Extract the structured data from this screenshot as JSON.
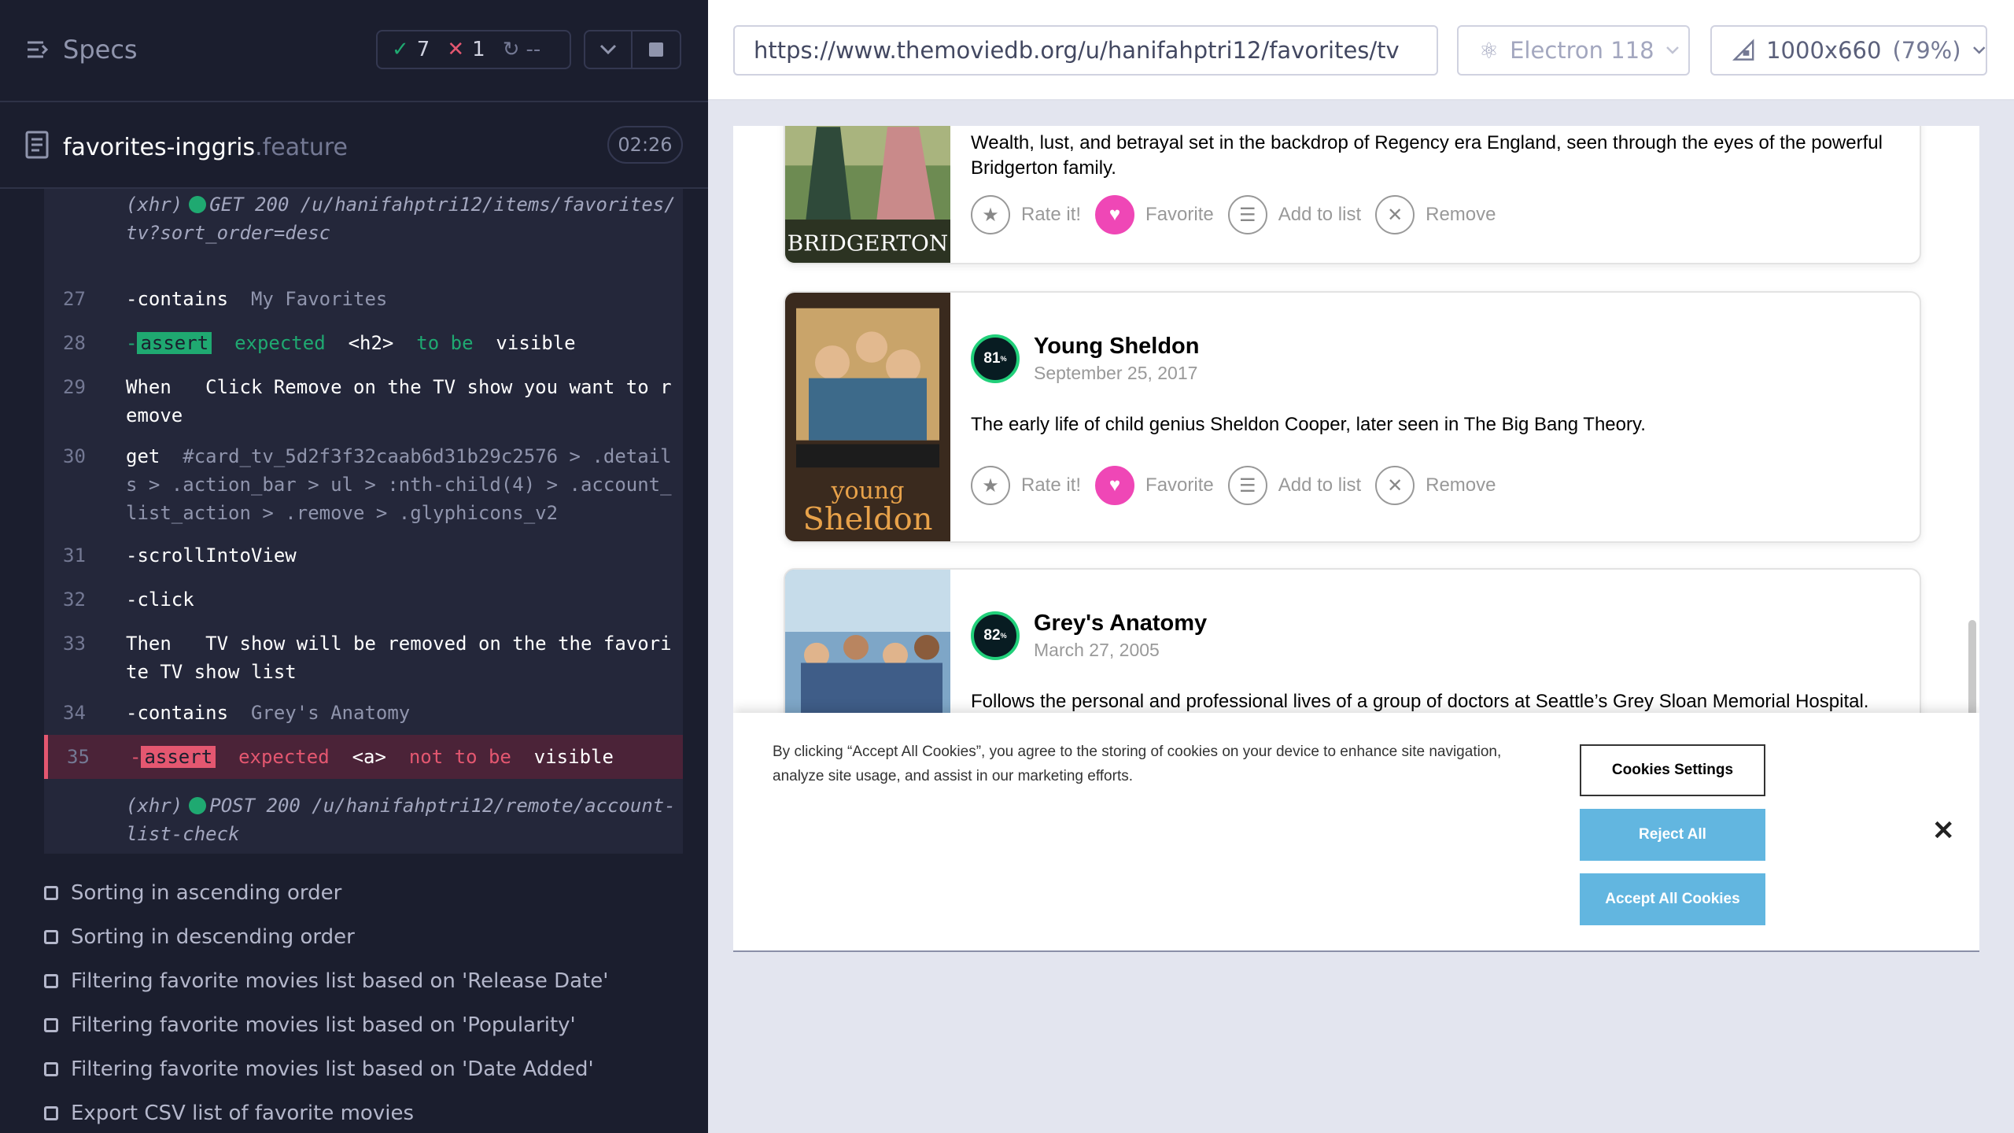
{
  "reporter": {
    "specs_label": "Specs",
    "stats": {
      "passed": "7",
      "failed": "1",
      "pending": "--"
    },
    "spec_file": {
      "name": "favorites-inggris",
      "ext": ".feature",
      "duration": "02:26"
    },
    "commands": [
      {
        "num": "",
        "lines": "(xhr)",
        "method": "GET 200",
        "path": "/u/hanifahptri12/items/favorites/tv?sort_order=desc"
      },
      {
        "num": "27",
        "cmd": "-contains",
        "arg": "My Favorites"
      },
      {
        "num": "28",
        "cmd": "-",
        "badge": "assert",
        "text": "expected",
        "el": "<h2>",
        "mid": "to be",
        "end": "visible"
      },
      {
        "num": "29",
        "cmd": "When",
        "text": "Click Remove on the TV show you want to remove"
      },
      {
        "num": "30",
        "cmd": "get",
        "arg": "#card_tv_5d2f3f32caab6d31b29c2576 > .details > .action_bar > ul > :nth-child(4) > .account_list_action > .remove > .glyphicons_v2"
      },
      {
        "num": "31",
        "cmd": "-scrollIntoView"
      },
      {
        "num": "32",
        "cmd": "-click"
      },
      {
        "num": "33",
        "cmd": "Then",
        "text": "TV show will be removed on the the favorite TV show list"
      },
      {
        "num": "34",
        "cmd": "-contains",
        "arg": "Grey's Anatomy"
      },
      {
        "num": "35",
        "cmd": "-",
        "badge": "assert",
        "text": "expected",
        "el": "<a>",
        "mid": "not to be",
        "end": "visible"
      },
      {
        "num": "",
        "lines": "(xhr)",
        "method": "POST 200",
        "path": "/u/hanifahptri12/remote/account-list-check"
      }
    ],
    "tests": [
      "Sorting in ascending order",
      "Sorting in descending order",
      "Filtering favorite movies list based on 'Release Date'",
      "Filtering favorite movies list based on 'Popularity'",
      "Filtering favorite movies list based on 'Date Added'",
      "Export CSV list of favorite movies"
    ]
  },
  "aut": {
    "url": "https://www.themoviedb.org/u/hanifahptri12/favorites/tv",
    "browser": "Electron 118",
    "viewport": "1000x660",
    "zoom": "(79%)"
  },
  "page": {
    "shows": [
      {
        "poster_text": "BRIDGERTON",
        "overview": "Wealth, lust, and betrayal set in the backdrop of Regency era England, seen through the eyes of the powerful Bridgerton family."
      },
      {
        "poster_text_1": "young",
        "poster_text_2": "Sheldon",
        "score": "81",
        "title": "Young Sheldon",
        "date": "September 25, 2017",
        "overview": "The early life of child genius Sheldon Cooper, later seen in The Big Bang Theory."
      },
      {
        "score": "82",
        "title": "Grey's Anatomy",
        "date": "March 27, 2005",
        "overview": "Follows the personal and professional lives of a group of doctors at Seattle’s Grey Sloan Memorial Hospital."
      }
    ],
    "actions": {
      "rate": "Rate it!",
      "favorite": "Favorite",
      "add_list": "Add to list",
      "remove": "Remove"
    },
    "score_suffix": "%",
    "cookie": {
      "text": "By clicking “Accept All Cookies”, you agree to the storing of cookies on your device to enhance site navigation, analyze site usage, and assist in our marketing efforts.",
      "settings": "Cookies Settings",
      "reject": "Reject All",
      "accept": "Accept All Cookies",
      "close": "✕"
    }
  },
  "colors": {
    "pass": "#1fa971",
    "fail": "#e45770",
    "favorite": "#ef47b6",
    "cookie_button": "#62b6e0",
    "score_ring": "#21d07a"
  }
}
